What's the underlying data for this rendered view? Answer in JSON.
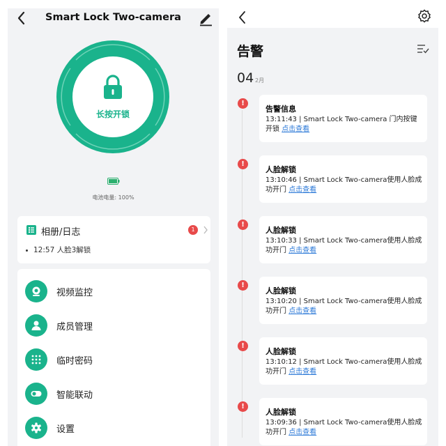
{
  "left": {
    "title": "Smart Lock Two-camera",
    "lock_button_label": "长按开锁",
    "battery_text": "电池电量: 100%",
    "album": {
      "title": "相册/日志",
      "badge_count": "1",
      "latest_time": "12:57",
      "latest_text": "人脸3解锁"
    },
    "menu": [
      {
        "label": "视频监控",
        "icon": "camera-icon"
      },
      {
        "label": "成员管理",
        "icon": "person-icon"
      },
      {
        "label": "临时密码",
        "icon": "keypad-icon"
      },
      {
        "label": "智能联动",
        "icon": "toggle-icon"
      },
      {
        "label": "设置",
        "icon": "gear-icon"
      }
    ]
  },
  "right": {
    "title": "告警",
    "day": "04",
    "month": "2月",
    "link_text": "点击查看",
    "alerts": [
      {
        "title": "告警信息",
        "desc": "13:11:43 | Smart Lock Two-camera 门内按键开锁 "
      },
      {
        "title": "人脸解锁",
        "desc": "13:10:46 | Smart Lock Two-camera使用人脸成功开门 "
      },
      {
        "title": "人脸解锁",
        "desc": "13:10:33 | Smart Lock Two-camera使用人脸成功开门 "
      },
      {
        "title": "人脸解锁",
        "desc": "13:10:20 | Smart Lock Two-camera使用人脸成功开门 "
      },
      {
        "title": "人脸解锁",
        "desc": "13:10:12 | Smart Lock Two-camera使用人脸成功开门 "
      },
      {
        "title": "人脸解锁",
        "desc": "13:09:36 | Smart Lock Two-camera使用人脸成功开门 "
      }
    ]
  },
  "colors": {
    "accent": "#1ab38c",
    "alert": "#e84a4a",
    "link": "#2f7bd8",
    "background": "#f2f3f5"
  }
}
